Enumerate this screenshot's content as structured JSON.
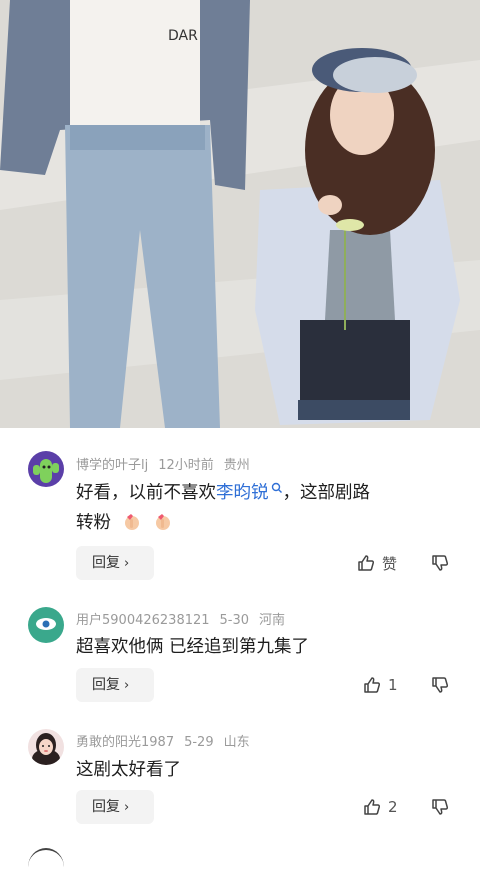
{
  "comments": [
    {
      "username": "博学的叶子lj",
      "time": "12小时前",
      "location": "贵州",
      "text_part1": "好看，以前不喜欢",
      "mention": "李昀锐",
      "text_part2": "，这部剧路",
      "text_line2": "转粉",
      "emoji_count": 2,
      "reply_label": "回复",
      "like_label": "赞",
      "avatar_color": "#4a7b3a"
    },
    {
      "username": "用户5900426238121",
      "time": "5-30",
      "location": "河南",
      "text": "超喜欢他俩 已经追到第九集了",
      "reply_label": "回复",
      "like_count": "1",
      "avatar_color": "#3aa88c"
    },
    {
      "username": "勇敢的阳光1987",
      "time": "5-29",
      "location": "山东",
      "text": "这剧太好看了",
      "reply_label": "回复",
      "like_count": "2",
      "avatar_color": "#e9c4c4"
    }
  ],
  "icons": {
    "search_icon": "search-icon",
    "thumb_up": "thumb-up-icon",
    "thumb_down": "thumb-down-icon",
    "chevron": "chevron-right-icon"
  },
  "colors": {
    "mention": "#2f6fd6",
    "meta_gray": "#9a9a9a",
    "reply_bg": "#f3f3f3"
  }
}
